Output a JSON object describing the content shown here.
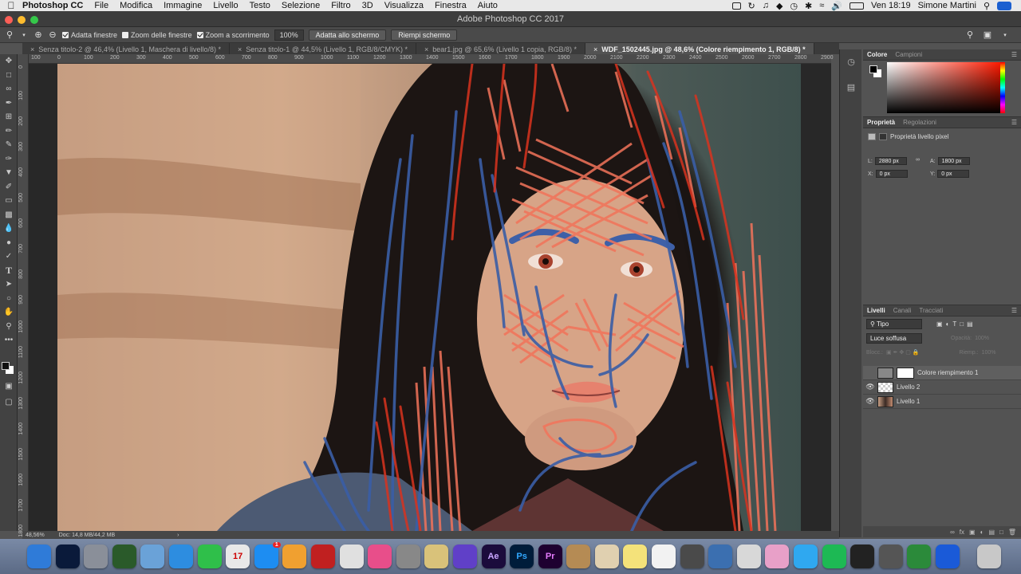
{
  "menubar": {
    "app_name": "Photoshop CC",
    "items": [
      "File",
      "Modifica",
      "Immagine",
      "Livello",
      "Testo",
      "Selezione",
      "Filtro",
      "3D",
      "Visualizza",
      "Finestra",
      "Aiuto"
    ],
    "clock": "Ven 18:19",
    "user": "Simone Martini"
  },
  "window": {
    "title": "Adobe Photoshop CC 2017"
  },
  "options": {
    "fit_windows": "Adatta finestre",
    "zoom_all_windows": "Zoom delle finestre",
    "scrubby_zoom": "Zoom a scorrimento",
    "zoom_value": "100%",
    "fit_screen": "Adatta allo schermo",
    "fill_screen": "Riempi schermo"
  },
  "tabs": [
    {
      "label": "Senza titolo-2 @ 46,4% (Livello 1, Maschera di livello/8) *"
    },
    {
      "label": "Senza titolo-1 @ 44,5% (Livello 1, RGB/8/CMYK) *"
    },
    {
      "label": "bear1.jpg @ 65,6% (Livello 1 copia, RGB/8) *"
    },
    {
      "label": "WDF_1502445.jpg @ 48,6% (Colore riempimento 1, RGB/8) *"
    }
  ],
  "ruler": {
    "top": [
      "100",
      "0",
      "100",
      "200",
      "300",
      "400",
      "500",
      "600",
      "700",
      "800",
      "900",
      "1000",
      "1100",
      "1200",
      "1300",
      "1400",
      "1500",
      "1600",
      "1700",
      "1800",
      "1900",
      "2000",
      "2100",
      "2200",
      "2300",
      "2400",
      "2500",
      "2600",
      "2700",
      "2800",
      "2900"
    ],
    "left": [
      "0",
      "100",
      "200",
      "300",
      "400",
      "500",
      "600",
      "700",
      "800",
      "900",
      "1000",
      "1100",
      "1200",
      "1300",
      "1400",
      "1500",
      "1600",
      "1700",
      "1800"
    ]
  },
  "panels": {
    "color_tabs": [
      "Colore",
      "Campioni"
    ],
    "props_tabs": [
      "Proprietà",
      "Regolazioni"
    ],
    "props_title": "Proprietà livello pixel",
    "w_label": "L:",
    "w_value": "2880 px",
    "h_label": "A:",
    "h_value": "1800 px",
    "x_label": "X:",
    "x_value": "0 px",
    "y_label": "Y:",
    "y_value": "0 px",
    "layers_tabs": [
      "Livelli",
      "Canali",
      "Tracciati"
    ],
    "filter_kind": "Tipo",
    "blend_mode": "Luce soffusa",
    "opacity_label": "Opacità:",
    "opacity_value": "100%",
    "lock_label": "Blocc.:",
    "fill_label": "Riemp.:",
    "fill_value": "100%",
    "layers": [
      {
        "name": "Colore riempimento 1",
        "visible": false
      },
      {
        "name": "Livello 2",
        "visible": true
      },
      {
        "name": "Livello 1",
        "visible": true
      }
    ]
  },
  "status": {
    "zoom": "48,56%",
    "doc": "Doc: 14,8 MB/44,2 MB"
  },
  "dock": {
    "badge": "1",
    "calendar_day": "17",
    "labels": {
      "ae": "Ae",
      "ps": "Ps",
      "pr": "Pr"
    },
    "colors": [
      "#2f7bd8",
      "#0a1a3a",
      "#8a8f99",
      "#2a5a2a",
      "#6aa2d8",
      "#2d8de0",
      "#2fbf4a",
      "#e8e8e8",
      "#1d8df2",
      "#f0a030",
      "#c02020",
      "#e0e0e0",
      "#e84e8a",
      "#888888",
      "#d9c27a",
      "#6040c8",
      "#1b0c3c",
      "#001c3a",
      "#1e0030",
      "#b58b54",
      "#e0d0b0",
      "#f4e27a",
      "#f2f2f2",
      "#4a4a4a",
      "#3b6fb0",
      "#d8d8d8",
      "#e8a0c8",
      "#2fa8f0",
      "#1db954",
      "#222222",
      "#555555",
      "#2b8a3a",
      "#1a5ad8",
      "#c8c8c8"
    ]
  }
}
